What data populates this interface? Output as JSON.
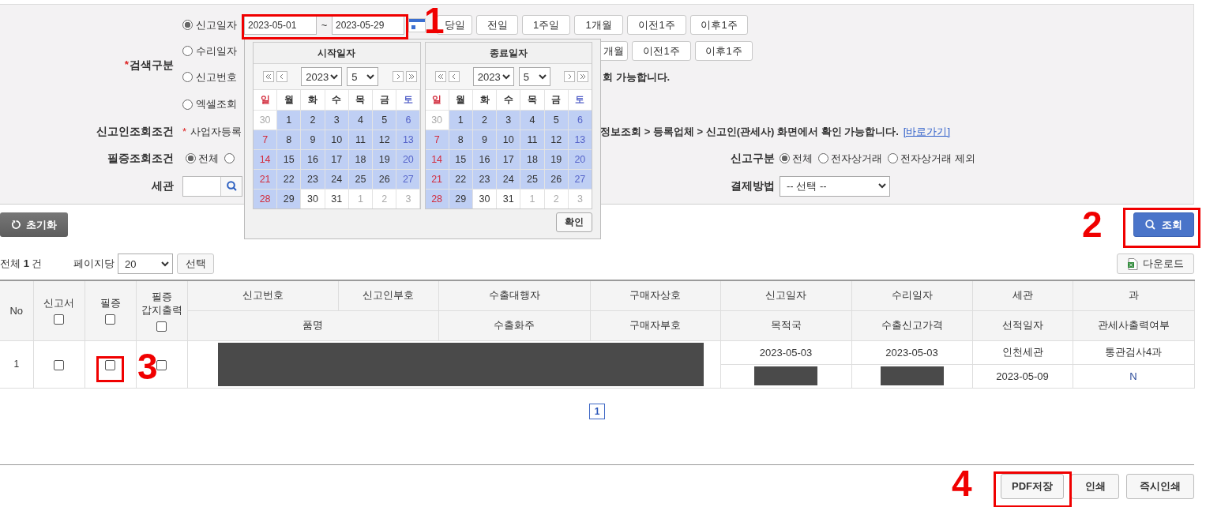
{
  "search_panel": {
    "search_type": {
      "required_mark": "*",
      "label": "검색구분",
      "options": [
        {
          "label": "신고일자",
          "selected": true,
          "start_date": "2023-05-01",
          "separator": "~",
          "end_date": "2023-05-29",
          "quick_buttons": [
            "당일",
            "전일",
            "1주일",
            "1개월",
            "이전1주",
            "이후1주"
          ]
        },
        {
          "label": "수리일자",
          "selected": false,
          "quick_buttons": [
            "개월",
            "이전1주",
            "이후1주"
          ]
        },
        {
          "label": "신고번호",
          "selected": false,
          "note": "회 가능합니다."
        },
        {
          "label": "엑셀조회",
          "selected": false
        }
      ]
    },
    "declarant": {
      "label": "신고인조회조건",
      "required_mark": "*",
      "text_left": "사업자등록",
      "text_right": "정보조회 > 등록업체 > 신고인(관세사) 화면에서 확인 가능합니다.",
      "link": "[바로가기]"
    },
    "cert_filter": {
      "label": "필증조회조건",
      "options": [
        {
          "label": "전체",
          "selected": true
        },
        {
          "selected": false
        }
      ]
    },
    "report_type": {
      "label": "신고구분",
      "options": [
        {
          "label": "전체",
          "selected": true
        },
        {
          "label": "전자상거래",
          "selected": false
        },
        {
          "label": "전자상거래 제외",
          "selected": false
        }
      ]
    },
    "customs": {
      "label": "세관"
    },
    "payment": {
      "label": "결제방법",
      "value": "-- 선택 --"
    }
  },
  "calendar_popup": {
    "confirm": "확인",
    "calendars": [
      {
        "title": "시작일자",
        "year": "2023",
        "month": "5",
        "weekdays": [
          "일",
          "월",
          "화",
          "수",
          "목",
          "금",
          "토"
        ],
        "weeks": [
          [
            {
              "day": "30",
              "in_range": false,
              "other_month": true
            },
            {
              "day": "1",
              "in_range": true,
              "other_month": false
            },
            {
              "day": "2",
              "in_range": true,
              "other_month": false
            },
            {
              "day": "3",
              "in_range": true,
              "other_month": false
            },
            {
              "day": "4",
              "in_range": true,
              "other_month": false
            },
            {
              "day": "5",
              "in_range": true,
              "other_month": false
            },
            {
              "day": "6",
              "in_range": true,
              "other_month": false
            }
          ],
          [
            {
              "day": "7",
              "in_range": true,
              "other_month": false
            },
            {
              "day": "8",
              "in_range": true,
              "other_month": false
            },
            {
              "day": "9",
              "in_range": true,
              "other_month": false
            },
            {
              "day": "10",
              "in_range": true,
              "other_month": false
            },
            {
              "day": "11",
              "in_range": true,
              "other_month": false
            },
            {
              "day": "12",
              "in_range": true,
              "other_month": false
            },
            {
              "day": "13",
              "in_range": true,
              "other_month": false
            }
          ],
          [
            {
              "day": "14",
              "in_range": true,
              "other_month": false
            },
            {
              "day": "15",
              "in_range": true,
              "other_month": false
            },
            {
              "day": "16",
              "in_range": true,
              "other_month": false
            },
            {
              "day": "17",
              "in_range": true,
              "other_month": false
            },
            {
              "day": "18",
              "in_range": true,
              "other_month": false
            },
            {
              "day": "19",
              "in_range": true,
              "other_month": false
            },
            {
              "day": "20",
              "in_range": true,
              "other_month": false
            }
          ],
          [
            {
              "day": "21",
              "in_range": true,
              "other_month": false
            },
            {
              "day": "22",
              "in_range": true,
              "other_month": false
            },
            {
              "day": "23",
              "in_range": true,
              "other_month": false
            },
            {
              "day": "24",
              "in_range": true,
              "other_month": false
            },
            {
              "day": "25",
              "in_range": true,
              "other_month": false
            },
            {
              "day": "26",
              "in_range": true,
              "other_month": false
            },
            {
              "day": "27",
              "in_range": true,
              "other_month": false
            }
          ],
          [
            {
              "day": "28",
              "in_range": true,
              "other_month": false
            },
            {
              "day": "29",
              "in_range": true,
              "other_month": false
            },
            {
              "day": "30",
              "in_range": false,
              "other_month": false
            },
            {
              "day": "31",
              "in_range": false,
              "other_month": false
            },
            {
              "day": "1",
              "in_range": false,
              "other_month": true
            },
            {
              "day": "2",
              "in_range": false,
              "other_month": true
            },
            {
              "day": "3",
              "in_range": false,
              "other_month": true
            }
          ]
        ]
      },
      {
        "title": "종료일자",
        "year": "2023",
        "month": "5",
        "weekdays": [
          "일",
          "월",
          "화",
          "수",
          "목",
          "금",
          "토"
        ],
        "weeks": [
          [
            {
              "day": "30",
              "in_range": false,
              "other_month": true
            },
            {
              "day": "1",
              "in_range": true,
              "other_month": false
            },
            {
              "day": "2",
              "in_range": true,
              "other_month": false
            },
            {
              "day": "3",
              "in_range": true,
              "other_month": false
            },
            {
              "day": "4",
              "in_range": true,
              "other_month": false
            },
            {
              "day": "5",
              "in_range": true,
              "other_month": false
            },
            {
              "day": "6",
              "in_range": true,
              "other_month": false
            }
          ],
          [
            {
              "day": "7",
              "in_range": true,
              "other_month": false
            },
            {
              "day": "8",
              "in_range": true,
              "other_month": false
            },
            {
              "day": "9",
              "in_range": true,
              "other_month": false
            },
            {
              "day": "10",
              "in_range": true,
              "other_month": false
            },
            {
              "day": "11",
              "in_range": true,
              "other_month": false
            },
            {
              "day": "12",
              "in_range": true,
              "other_month": false
            },
            {
              "day": "13",
              "in_range": true,
              "other_month": false
            }
          ],
          [
            {
              "day": "14",
              "in_range": true,
              "other_month": false
            },
            {
              "day": "15",
              "in_range": true,
              "other_month": false
            },
            {
              "day": "16",
              "in_range": true,
              "other_month": false
            },
            {
              "day": "17",
              "in_range": true,
              "other_month": false
            },
            {
              "day": "18",
              "in_range": true,
              "other_month": false
            },
            {
              "day": "19",
              "in_range": true,
              "other_month": false
            },
            {
              "day": "20",
              "in_range": true,
              "other_month": false
            }
          ],
          [
            {
              "day": "21",
              "in_range": true,
              "other_month": false
            },
            {
              "day": "22",
              "in_range": true,
              "other_month": false
            },
            {
              "day": "23",
              "in_range": true,
              "other_month": false
            },
            {
              "day": "24",
              "in_range": true,
              "other_month": false
            },
            {
              "day": "25",
              "in_range": true,
              "other_month": false
            },
            {
              "day": "26",
              "in_range": true,
              "other_month": false
            },
            {
              "day": "27",
              "in_range": true,
              "other_month": false
            }
          ],
          [
            {
              "day": "28",
              "in_range": true,
              "other_month": false
            },
            {
              "day": "29",
              "in_range": true,
              "other_month": false
            },
            {
              "day": "30",
              "in_range": false,
              "other_month": false
            },
            {
              "day": "31",
              "in_range": false,
              "other_month": false
            },
            {
              "day": "1",
              "in_range": false,
              "other_month": true
            },
            {
              "day": "2",
              "in_range": false,
              "other_month": true
            },
            {
              "day": "3",
              "in_range": false,
              "other_month": true
            }
          ]
        ]
      }
    ]
  },
  "actions": {
    "reset": "초기화",
    "search": "조회"
  },
  "list_bar": {
    "total": "전체 **1** 건",
    "per_page_label": "페이지당",
    "per_page": "20",
    "apply": "선택",
    "download": "다운로드"
  },
  "table": {
    "fixed_columns": [
      {
        "label": "No"
      },
      {
        "label": "신고서",
        "checked": false
      },
      {
        "label": "필증",
        "checked": false
      },
      {
        "label": "필증\n갑지출력",
        "checked": false
      }
    ],
    "header_row_1": [
      "신고번호",
      "신고인부호",
      "수출대행자",
      "구매자상호",
      "신고일자",
      "수리일자",
      "세관",
      "과"
    ],
    "header_row_2": [
      "품명",
      "수출화주",
      "구매자부호",
      "목적국",
      "수출신고가격",
      "선적일자",
      "관세사출력여부"
    ],
    "rows": [
      {
        "no": "1",
        "checks": [
          false,
          false,
          false
        ],
        "wide_redacted": true,
        "line_1": [
          {
            "kind": "text",
            "text": "2023-05-03"
          },
          {
            "kind": "text",
            "text": "2023-05-03"
          },
          {
            "kind": "text",
            "text": "인천세관"
          },
          {
            "kind": "text",
            "text": "통관검사4과"
          }
        ],
        "line_2": [
          {
            "kind": "redacted"
          },
          {
            "kind": "redacted"
          },
          {
            "kind": "text",
            "text": "2023-05-09"
          },
          {
            "kind": "flag",
            "text": "N"
          }
        ]
      }
    ]
  },
  "pagination": [
    {
      "label": "1",
      "selected": true
    }
  ],
  "footer_buttons": [
    "PDF저장",
    "인쇄",
    "즉시인쇄"
  ],
  "annotations": [
    {
      "number": "1"
    },
    {
      "number": "2"
    },
    {
      "number": "3"
    },
    {
      "number": "4"
    }
  ]
}
